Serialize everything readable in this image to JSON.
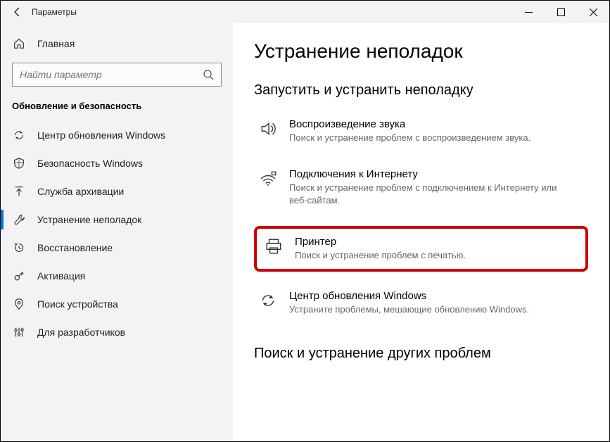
{
  "window": {
    "title": "Параметры"
  },
  "sidebar": {
    "home": "Главная",
    "search_placeholder": "Найти параметр",
    "section": "Обновление и безопасность",
    "items": [
      {
        "label": "Центр обновления Windows"
      },
      {
        "label": "Безопасность Windows"
      },
      {
        "label": "Служба архивации"
      },
      {
        "label": "Устранение неполадок"
      },
      {
        "label": "Восстановление"
      },
      {
        "label": "Активация"
      },
      {
        "label": "Поиск устройства"
      },
      {
        "label": "Для разработчиков"
      }
    ]
  },
  "content": {
    "page_title": "Устранение неполадок",
    "subheading1": "Запустить и устранить неполадку",
    "items": [
      {
        "title": "Воспроизведение звука",
        "desc": "Поиск и устранение проблем с воспроизведением звука."
      },
      {
        "title": "Подключения к Интернету",
        "desc": "Поиск и устранение проблем с подключением к Интернету или веб-сайтам."
      },
      {
        "title": "Принтер",
        "desc": "Поиск и устранение проблем с печатью."
      },
      {
        "title": "Центр обновления Windows",
        "desc": "Устраните проблемы, мешающие обновлению Windows."
      }
    ],
    "subheading2": "Поиск и устранение других проблем"
  }
}
